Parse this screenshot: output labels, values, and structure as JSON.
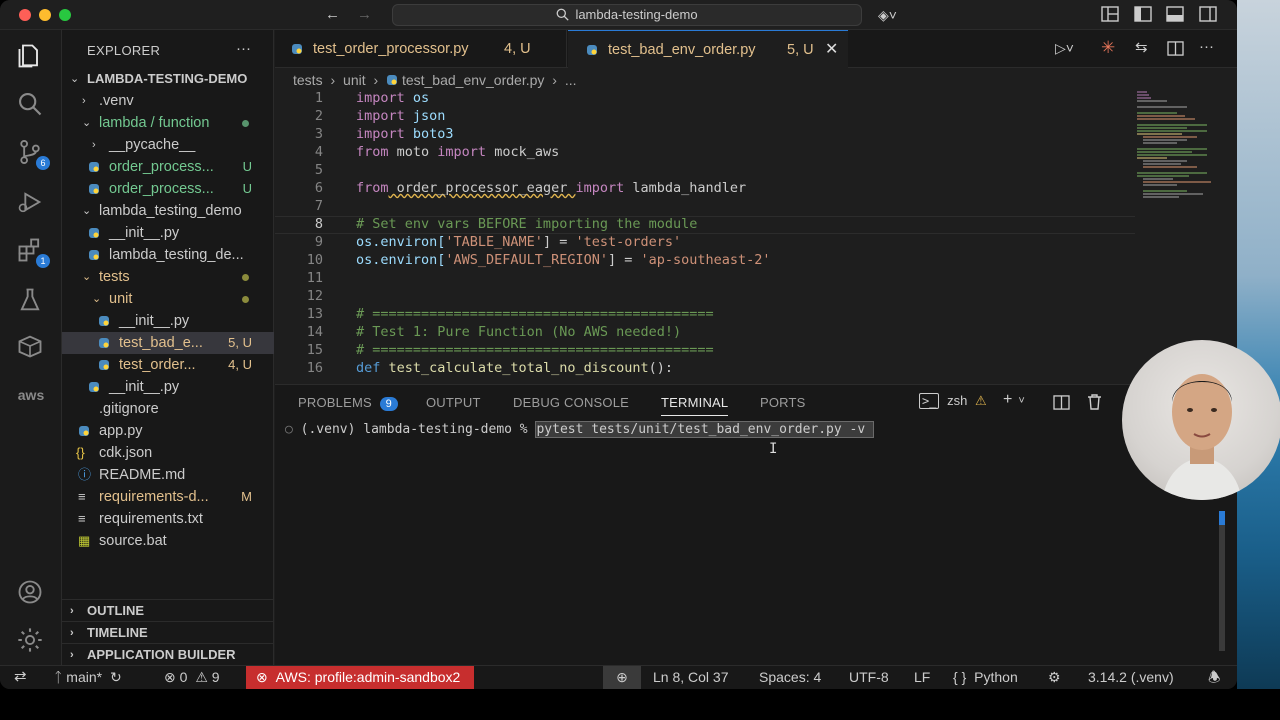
{
  "window": {
    "search_text": "lambda-testing-demo"
  },
  "activity_bar": {
    "scm_badge": "6",
    "extensions_badge": "1",
    "aws_label": "aws"
  },
  "explorer": {
    "header": "EXPLORER",
    "root": "LAMBDA-TESTING-DEMO",
    "items": [
      {
        "label": ".venv",
        "status": ""
      },
      {
        "label": "lambda / function",
        "status": ""
      },
      {
        "label": "__pycache__",
        "status": ""
      },
      {
        "label": "order_process...",
        "status": "U"
      },
      {
        "label": "order_process...",
        "status": "U"
      },
      {
        "label": "lambda_testing_demo",
        "status": ""
      },
      {
        "label": "__init__.py",
        "status": ""
      },
      {
        "label": "lambda_testing_de...",
        "status": ""
      },
      {
        "label": "tests",
        "status": ""
      },
      {
        "label": "unit",
        "status": ""
      },
      {
        "label": "__init__.py",
        "status": ""
      },
      {
        "label": "test_bad_e...",
        "status": "5, U"
      },
      {
        "label": "test_order...",
        "status": "4, U"
      },
      {
        "label": "__init__.py",
        "status": ""
      },
      {
        "label": ".gitignore",
        "status": ""
      },
      {
        "label": "app.py",
        "status": ""
      },
      {
        "label": "cdk.json",
        "status": ""
      },
      {
        "label": "README.md",
        "status": ""
      },
      {
        "label": "requirements-d...",
        "status": "M"
      },
      {
        "label": "requirements.txt",
        "status": ""
      },
      {
        "label": "source.bat",
        "status": ""
      }
    ],
    "sections": [
      "OUTLINE",
      "TIMELINE",
      "APPLICATION BUILDER"
    ]
  },
  "tabs": [
    {
      "label": "test_order_processor.py",
      "status": "4, U"
    },
    {
      "label": "test_bad_env_order.py",
      "status": "5, U"
    }
  ],
  "breadcrumb": [
    "tests",
    "unit",
    "test_bad_env_order.py",
    "..."
  ],
  "code": {
    "line_numbers": [
      "1",
      "2",
      "3",
      "4",
      "5",
      "6",
      "7",
      "8",
      "9",
      "10",
      "11",
      "12",
      "13",
      "14",
      "15",
      "16"
    ],
    "l1": {
      "k": "import",
      "t": " os"
    },
    "l2": {
      "k": "import",
      "t": " json"
    },
    "l3": {
      "k": "import",
      "t": " boto3"
    },
    "l4": {
      "k1": "from",
      "m": " moto ",
      "k2": "import",
      "t": " mock_aws"
    },
    "l6": {
      "k1": "from",
      "m": " order_processor_eager ",
      "k2": "import",
      "t": " lambda_handler"
    },
    "l8": "# Set env vars BEFORE importing the module",
    "l9": {
      "a": "os.environ[",
      "s": "'TABLE_NAME'",
      "b": "] = ",
      "v": "'test-orders'"
    },
    "l10": {
      "a": "os.environ[",
      "s": "'AWS_DEFAULT_REGION'",
      "b": "] = ",
      "v": "'ap-southeast-2'"
    },
    "l13": "# ==========================================",
    "l14": "# Test 1: Pure Function (No AWS needed!)",
    "l15": "# ==========================================",
    "l16": {
      "k": "def",
      "f": " test_calculate_total_no_discount",
      "t": "():"
    }
  },
  "panel": {
    "tabs": [
      "PROBLEMS",
      "OUTPUT",
      "DEBUG CONSOLE",
      "TERMINAL",
      "PORTS"
    ],
    "problems_count": "9",
    "shell": "zsh",
    "prompt": "(.venv) lambda-testing-demo % ",
    "command": "pytest tests/unit/test_bad_env_order.py -v "
  },
  "status": {
    "branch": "main*",
    "errors": "0",
    "warnings": "9",
    "aws": "AWS: profile:admin-sandbox2",
    "position": "Ln 8, Col 37",
    "spaces": "Spaces: 4",
    "encoding": "UTF-8",
    "eol": "LF",
    "language": "Python",
    "interpreter": "3.14.2 (.venv)"
  }
}
